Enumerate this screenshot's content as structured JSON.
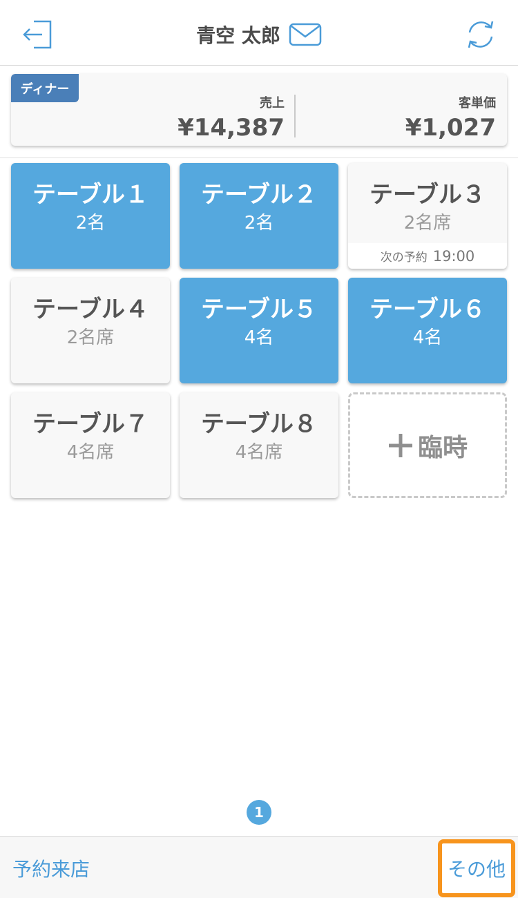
{
  "header": {
    "title": "青空 太郎",
    "icons": {
      "logout": "logout-icon",
      "mail": "mail-icon",
      "refresh": "refresh-icon"
    }
  },
  "sales": {
    "badge": "ディナー",
    "sales_label": "売上",
    "sales_value": "¥14,387",
    "per_customer_label": "客単価",
    "per_customer_value": "¥1,027"
  },
  "tables": [
    {
      "name": "テーブル１",
      "sub": "2名",
      "status": "occupied"
    },
    {
      "name": "テーブル２",
      "sub": "2名",
      "status": "occupied"
    },
    {
      "name": "テーブル３",
      "sub": "2名席",
      "status": "vacant",
      "next_label": "次の予約",
      "next_time": "19:00"
    },
    {
      "name": "テーブル４",
      "sub": "2名席",
      "status": "vacant"
    },
    {
      "name": "テーブル５",
      "sub": "4名",
      "status": "occupied"
    },
    {
      "name": "テーブル６",
      "sub": "4名",
      "status": "occupied"
    },
    {
      "name": "テーブル７",
      "sub": "4名席",
      "status": "vacant"
    },
    {
      "name": "テーブル８",
      "sub": "4名席",
      "status": "vacant"
    }
  ],
  "temporary": {
    "label": "臨時",
    "icon": "plus-icon"
  },
  "pager": {
    "current": "1"
  },
  "footer": {
    "reserve_label": "予約来店",
    "other_label": "その他"
  },
  "colors": {
    "accent": "#55a8de",
    "badge": "#4a7fb8",
    "highlight": "#f7941d"
  }
}
